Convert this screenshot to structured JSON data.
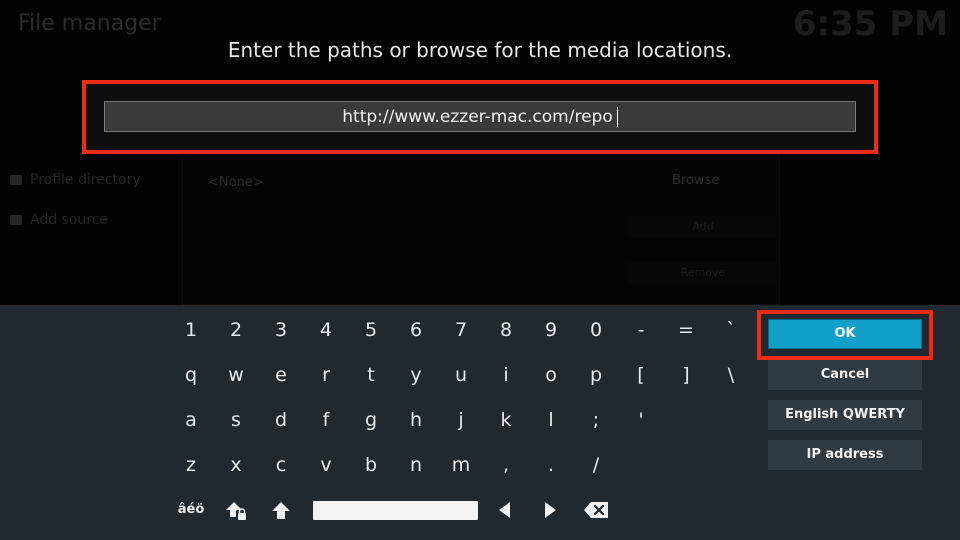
{
  "background": {
    "window_title": "File manager",
    "clock": "6:35 PM",
    "sidebar": [
      {
        "label": "Profile directory"
      },
      {
        "label": "Add source"
      }
    ],
    "dialog_none": "<None>",
    "dialog_browse": "Browse",
    "dialog_add": "Add",
    "dialog_remove": "Remove"
  },
  "prompt": "Enter the paths or browse for the media locations.",
  "path_input": {
    "value": "http://www.ezzer-mac.com/repo"
  },
  "keyboard": {
    "rows": [
      [
        "1",
        "2",
        "3",
        "4",
        "5",
        "6",
        "7",
        "8",
        "9",
        "0",
        "-",
        "=",
        "`"
      ],
      [
        "q",
        "w",
        "e",
        "r",
        "t",
        "y",
        "u",
        "i",
        "o",
        "p",
        "[",
        "]",
        "\\"
      ],
      [
        "a",
        "s",
        "d",
        "f",
        "g",
        "h",
        "j",
        "k",
        "l",
        ";",
        "'"
      ],
      [
        "z",
        "x",
        "c",
        "v",
        "b",
        "n",
        "m",
        ",",
        ".",
        "/"
      ]
    ],
    "symbols_label": "âéö",
    "icons": [
      "caps-lock-icon",
      "shift-icon",
      "space-key",
      "arrow-left-icon",
      "arrow-right-icon",
      "backspace-icon"
    ]
  },
  "buttons": {
    "ok": "OK",
    "cancel": "Cancel",
    "layout": "English QWERTY",
    "ip": "IP address"
  },
  "colors": {
    "highlight": "#ef2b12",
    "ok_button": "#12a0c8",
    "keyboard_bg": "#202930",
    "button_bg": "#303a42"
  }
}
